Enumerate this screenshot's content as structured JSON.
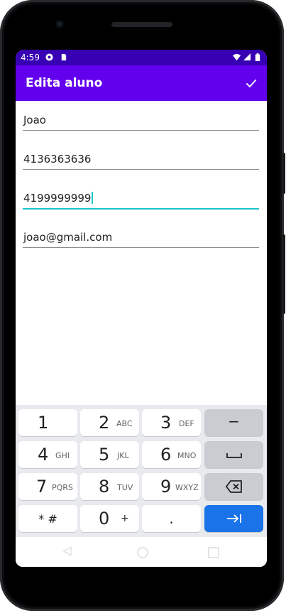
{
  "status_bar": {
    "time": "4:59"
  },
  "app_bar": {
    "title": "Edita aluno"
  },
  "form": {
    "name": "Joao",
    "phone": "4136363636",
    "cell": "4199999999",
    "email": "joao@gmail.com"
  },
  "keyboard": {
    "keys": [
      {
        "num": "1",
        "letters": ""
      },
      {
        "num": "2",
        "letters": "ABC"
      },
      {
        "num": "3",
        "letters": "DEF"
      },
      {
        "num": "4",
        "letters": "GHI"
      },
      {
        "num": "5",
        "letters": "JKL"
      },
      {
        "num": "6",
        "letters": "MNO"
      },
      {
        "num": "7",
        "letters": "PQRS"
      },
      {
        "num": "8",
        "letters": "TUV"
      },
      {
        "num": "9",
        "letters": "WXYZ"
      },
      {
        "num": "0",
        "letters": "+"
      }
    ],
    "star_hash": "* #",
    "minus": "−",
    "dot": "."
  },
  "colors": {
    "status_bar": "#3700b3",
    "app_bar": "#6200ee",
    "focus": "#1bc6c6",
    "enter_key": "#1a73e8"
  },
  "icons": [
    "check-icon",
    "backspace-icon",
    "space-icon",
    "next-arrow-icon",
    "wifi-icon",
    "signal-icon",
    "battery-icon"
  ]
}
